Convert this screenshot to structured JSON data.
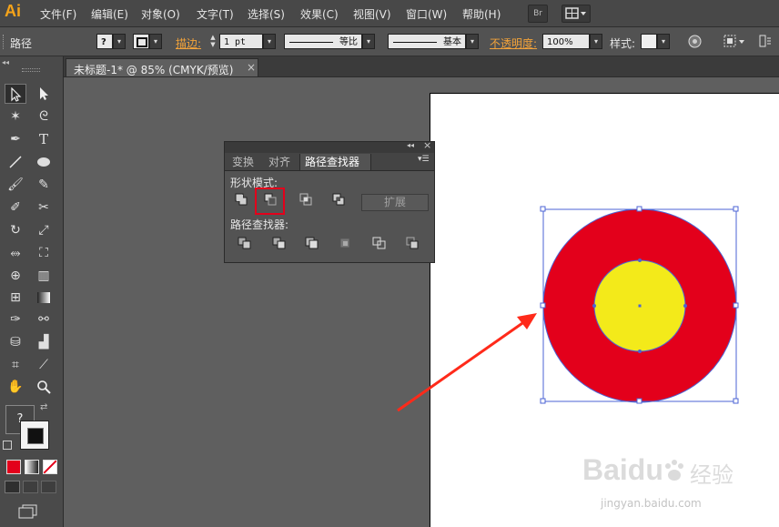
{
  "app": {
    "logo": "Ai"
  },
  "menubar": {
    "items": [
      "文件(F)",
      "编辑(E)",
      "对象(O)",
      "文字(T)",
      "选择(S)",
      "效果(C)",
      "视图(V)",
      "窗口(W)",
      "帮助(H)"
    ],
    "bridge_label": "Br"
  },
  "controlbar": {
    "object_type": "路径",
    "fill_swatch": "?",
    "stroke_label": "描边:",
    "stroke_weight": "1 pt",
    "stroke_profile": "等比",
    "brush_label": "基本",
    "opacity_label": "不透明度:",
    "opacity_value": "100%",
    "style_label": "样式:"
  },
  "document": {
    "tab_title": "未标题-1* @ 85% (CMYK/预览)",
    "close_glyph": "×"
  },
  "toolbar": {
    "fill_unknown": "?"
  },
  "pathfinder_panel": {
    "tabs": [
      "变换",
      "对齐",
      "路径查找器"
    ],
    "active_tab": "路径查找器",
    "shape_modes_label": "形状模式:",
    "pathfinders_label": "路径查找器:",
    "expand_label": "扩展",
    "collapse_glyph": "◂◂",
    "close_glyph": "×"
  },
  "artwork": {
    "outer_circle_color": "#e3001b",
    "inner_circle_color": "#f3ea1a",
    "selection_color": "#4b63d4",
    "arrow_color": "#ff2a1a",
    "highlight_color": "#e3001b"
  },
  "watermark": {
    "brand": "Baidu",
    "suffix": "经验",
    "url": "jingyan.baidu.com"
  }
}
